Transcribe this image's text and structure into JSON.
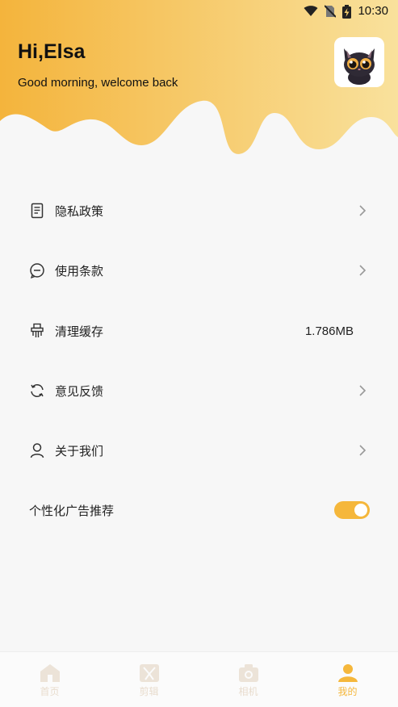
{
  "status_bar": {
    "time": "10:30"
  },
  "header": {
    "greeting": "Hi,Elsa",
    "subtitle": "Good morning, welcome back"
  },
  "menu": {
    "items": [
      {
        "label": "隐私政策",
        "icon": "document-icon"
      },
      {
        "label": "使用条款",
        "icon": "chat-bubble-icon"
      },
      {
        "label": "清理缓存",
        "icon": "broom-icon",
        "value": "1.786MB"
      },
      {
        "label": "意见反馈",
        "icon": "refresh-icon"
      },
      {
        "label": "关于我们",
        "icon": "person-icon"
      },
      {
        "label": "个性化广告推荐",
        "toggle_on": true
      }
    ]
  },
  "tabbar": {
    "tabs": [
      {
        "label": "首页",
        "icon": "home-icon"
      },
      {
        "label": "剪辑",
        "icon": "clapper-icon"
      },
      {
        "label": "相机",
        "icon": "camera-icon"
      },
      {
        "label": "我的",
        "icon": "profile-icon",
        "active": true
      }
    ]
  },
  "colors": {
    "accent": "#f5b73b",
    "header_from": "#f5b73b",
    "header_to": "#f8e3a0"
  }
}
